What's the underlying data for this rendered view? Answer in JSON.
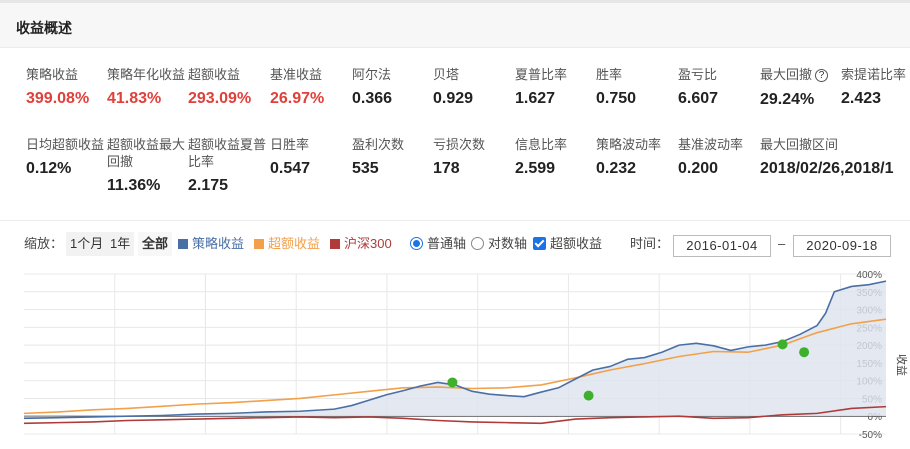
{
  "header": {
    "title": "收益概述"
  },
  "metrics_row1": [
    {
      "label": "策略收益",
      "value": "399.08%",
      "red": true
    },
    {
      "label": "策略年化收益",
      "value": "41.83%",
      "red": true
    },
    {
      "label": "超额收益",
      "value": "293.09%",
      "red": true
    },
    {
      "label": "基准收益",
      "value": "26.97%",
      "red": true
    },
    {
      "label": "阿尔法",
      "value": "0.366"
    },
    {
      "label": "贝塔",
      "value": "0.929"
    },
    {
      "label": "夏普比率",
      "value": "1.627"
    },
    {
      "label": "胜率",
      "value": "0.750"
    },
    {
      "label": "盈亏比",
      "value": "6.607"
    },
    {
      "label": "最大回撤",
      "value": "29.24%",
      "help": "?"
    },
    {
      "label": "索提诺比率",
      "value": "2.423"
    }
  ],
  "metrics_row2": [
    {
      "label": "日均超额收益",
      "value": "0.12%"
    },
    {
      "label": "超额收益最大回撤",
      "value": "11.36%"
    },
    {
      "label": "超额收益夏普比率",
      "value": "2.175"
    },
    {
      "label": "日胜率",
      "value": "0.547"
    },
    {
      "label": "盈利次数",
      "value": "535"
    },
    {
      "label": "亏损次数",
      "value": "178"
    },
    {
      "label": "信息比率",
      "value": "2.599"
    },
    {
      "label": "策略波动率",
      "value": "0.232"
    },
    {
      "label": "基准波动率",
      "value": "0.200"
    },
    {
      "label": "最大回撤区间",
      "value": "2018/02/26,2018/1"
    }
  ],
  "controls": {
    "zoom_label": "缩放：",
    "zoom_options": [
      "1个月",
      "1年",
      "全部"
    ],
    "zoom_selected": "全部",
    "legend": [
      {
        "label": "策略收益",
        "color": "#4a6fa5"
      },
      {
        "label": "超额收益",
        "color": "#f2a04a"
      },
      {
        "label": "沪深300",
        "color": "#b03a3a"
      }
    ],
    "axis_normal": "普通轴",
    "axis_log": "对数轴",
    "excess_toggle": "超额收益",
    "time_label": "时间：",
    "start_date": "2016-01-04",
    "date_sep": "–",
    "end_date": "2020-09-18"
  },
  "chart_data": {
    "type": "line",
    "ylabel": "收益",
    "y_ticks": [
      "400%",
      "350%",
      "300%",
      "250%",
      "200%",
      "150%",
      "100%",
      "50%",
      "0%",
      "-50%"
    ],
    "ylim": [
      -50,
      400
    ],
    "xlim": [
      "2016-01-04",
      "2020-09-18"
    ],
    "series": [
      {
        "name": "策略收益",
        "color": "#4a6fa5",
        "values": [
          [
            0,
            -6
          ],
          [
            0.04,
            -4
          ],
          [
            0.08,
            -2
          ],
          [
            0.12,
            0
          ],
          [
            0.16,
            2
          ],
          [
            0.2,
            6
          ],
          [
            0.24,
            8
          ],
          [
            0.28,
            12
          ],
          [
            0.32,
            14
          ],
          [
            0.36,
            20
          ],
          [
            0.38,
            30
          ],
          [
            0.4,
            45
          ],
          [
            0.42,
            60
          ],
          [
            0.44,
            72
          ],
          [
            0.46,
            85
          ],
          [
            0.48,
            95
          ],
          [
            0.5,
            88
          ],
          [
            0.52,
            70
          ],
          [
            0.54,
            62
          ],
          [
            0.56,
            58
          ],
          [
            0.58,
            55
          ],
          [
            0.6,
            68
          ],
          [
            0.62,
            80
          ],
          [
            0.64,
            105
          ],
          [
            0.66,
            130
          ],
          [
            0.68,
            140
          ],
          [
            0.7,
            160
          ],
          [
            0.72,
            165
          ],
          [
            0.74,
            180
          ],
          [
            0.76,
            200
          ],
          [
            0.78,
            205
          ],
          [
            0.8,
            198
          ],
          [
            0.82,
            185
          ],
          [
            0.84,
            195
          ],
          [
            0.86,
            200
          ],
          [
            0.88,
            210
          ],
          [
            0.9,
            230
          ],
          [
            0.92,
            255
          ],
          [
            0.93,
            290
          ],
          [
            0.94,
            350
          ],
          [
            0.96,
            365
          ],
          [
            0.98,
            370
          ],
          [
            1.0,
            380
          ]
        ]
      },
      {
        "name": "超额收益",
        "color": "#f2a04a",
        "values": [
          [
            0,
            8
          ],
          [
            0.04,
            12
          ],
          [
            0.08,
            18
          ],
          [
            0.12,
            22
          ],
          [
            0.16,
            28
          ],
          [
            0.2,
            34
          ],
          [
            0.24,
            38
          ],
          [
            0.28,
            44
          ],
          [
            0.32,
            50
          ],
          [
            0.36,
            60
          ],
          [
            0.4,
            70
          ],
          [
            0.44,
            80
          ],
          [
            0.48,
            82
          ],
          [
            0.52,
            78
          ],
          [
            0.56,
            80
          ],
          [
            0.6,
            88
          ],
          [
            0.64,
            108
          ],
          [
            0.68,
            130
          ],
          [
            0.72,
            148
          ],
          [
            0.76,
            168
          ],
          [
            0.8,
            182
          ],
          [
            0.84,
            180
          ],
          [
            0.88,
            200
          ],
          [
            0.92,
            235
          ],
          [
            0.96,
            260
          ],
          [
            1.0,
            273
          ]
        ]
      },
      {
        "name": "沪深300",
        "color": "#b03a3a",
        "values": [
          [
            0,
            -20
          ],
          [
            0.04,
            -18
          ],
          [
            0.08,
            -16
          ],
          [
            0.12,
            -12
          ],
          [
            0.16,
            -10
          ],
          [
            0.2,
            -8
          ],
          [
            0.24,
            -6
          ],
          [
            0.28,
            -4
          ],
          [
            0.32,
            -2
          ],
          [
            0.36,
            -4
          ],
          [
            0.4,
            -2
          ],
          [
            0.44,
            -6
          ],
          [
            0.48,
            -12
          ],
          [
            0.52,
            -16
          ],
          [
            0.56,
            -18
          ],
          [
            0.6,
            -20
          ],
          [
            0.64,
            -8
          ],
          [
            0.68,
            -4
          ],
          [
            0.72,
            -2
          ],
          [
            0.76,
            0
          ],
          [
            0.8,
            -6
          ],
          [
            0.84,
            -4
          ],
          [
            0.88,
            4
          ],
          [
            0.92,
            8
          ],
          [
            0.96,
            22
          ],
          [
            1.0,
            27
          ]
        ]
      }
    ],
    "markers": [
      [
        0.497,
        95
      ],
      [
        0.655,
        58
      ],
      [
        0.88,
        202
      ],
      [
        0.905,
        180
      ]
    ],
    "marker_color": "#3fb02e",
    "area_fill": "#dde4ee",
    "grid": true
  }
}
